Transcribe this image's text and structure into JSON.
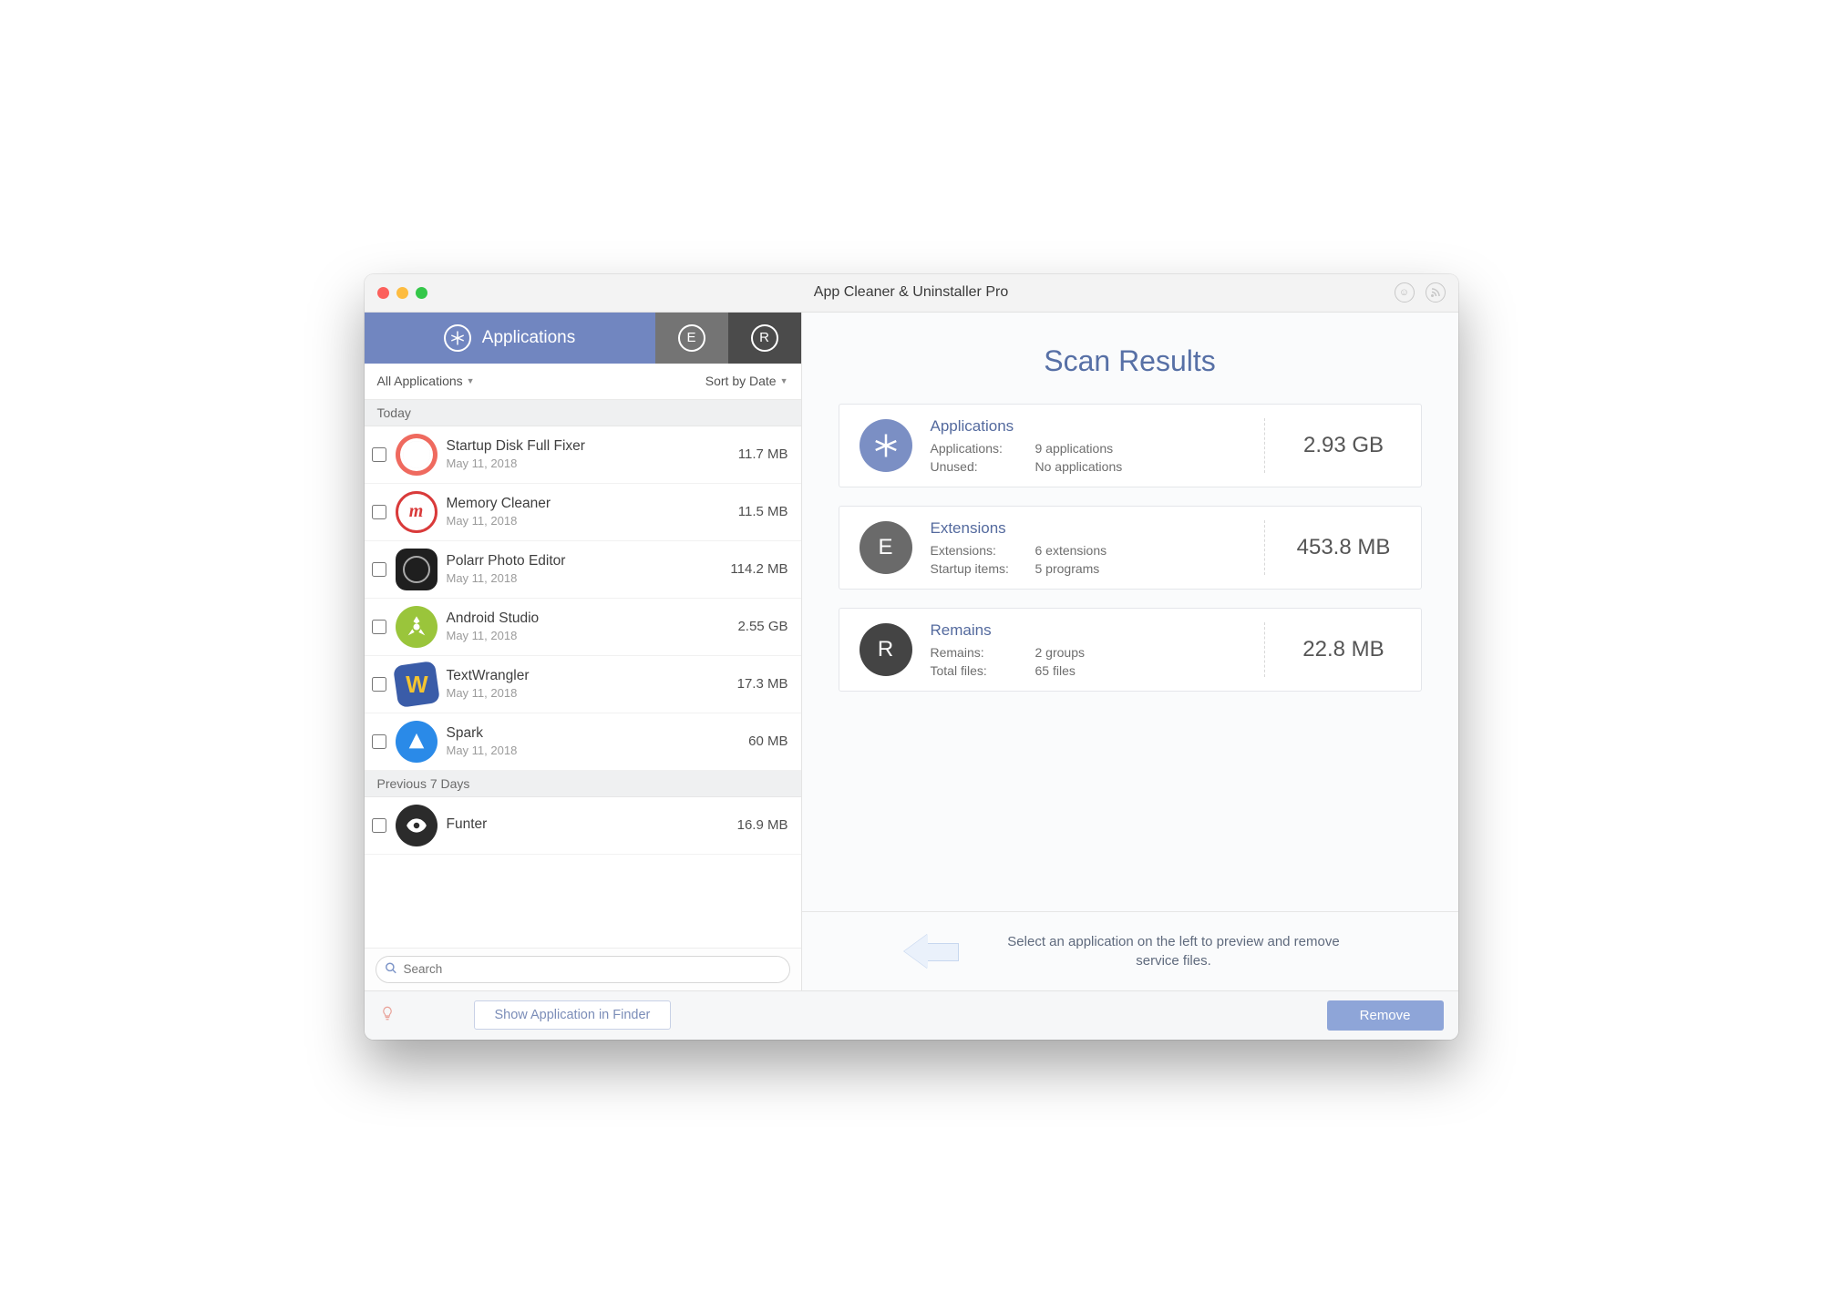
{
  "window": {
    "title": "App Cleaner & Uninstaller Pro"
  },
  "tabs": {
    "applications": "Applications"
  },
  "filter": {
    "all": "All Applications",
    "sort": "Sort by Date"
  },
  "sections": {
    "today": "Today",
    "prev7": "Previous 7 Days"
  },
  "apps": [
    {
      "name": "Startup Disk Full Fixer",
      "date": "May 11, 2018",
      "size": "11.7 MB"
    },
    {
      "name": "Memory Cleaner",
      "date": "May 11, 2018",
      "size": "11.5 MB"
    },
    {
      "name": "Polarr Photo Editor",
      "date": "May 11, 2018",
      "size": "114.2 MB"
    },
    {
      "name": "Android Studio",
      "date": "May 11, 2018",
      "size": "2.55 GB"
    },
    {
      "name": "TextWrangler",
      "date": "May 11, 2018",
      "size": "17.3 MB"
    },
    {
      "name": "Spark",
      "date": "May 11, 2018",
      "size": "60 MB"
    },
    {
      "name": "Funter",
      "date": "",
      "size": "16.9 MB"
    }
  ],
  "search": {
    "placeholder": "Search"
  },
  "footer": {
    "finder": "Show Application in Finder",
    "remove": "Remove"
  },
  "scan": {
    "title": "Scan Results",
    "cards": {
      "applications": {
        "title": "Applications",
        "row1k": "Applications:",
        "row1v": "9 applications",
        "row2k": "Unused:",
        "row2v": "No applications",
        "size": "2.93 GB"
      },
      "extensions": {
        "title": "Extensions",
        "row1k": "Extensions:",
        "row1v": "6 extensions",
        "row2k": "Startup items:",
        "row2v": "5 programs",
        "size": "453.8 MB"
      },
      "remains": {
        "title": "Remains",
        "row1k": "Remains:",
        "row1v": "2 groups",
        "row2k": "Total files:",
        "row2v": "65 files",
        "size": "22.8 MB"
      }
    },
    "hint": "Select an application on the left to preview and remove service files."
  }
}
